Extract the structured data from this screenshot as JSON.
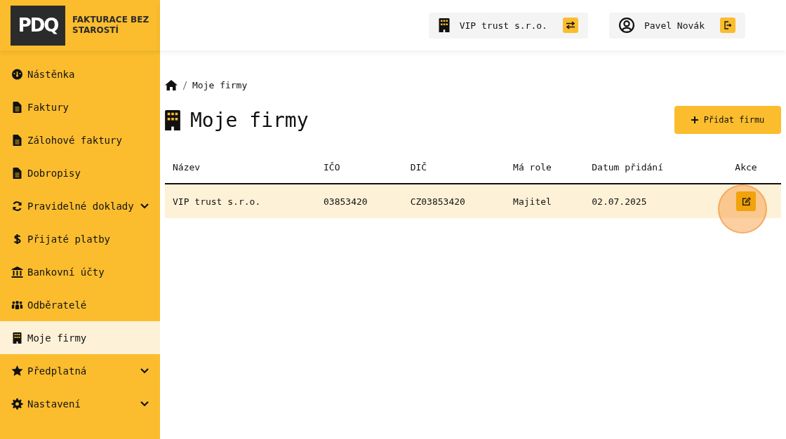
{
  "logo": {
    "mark": "PDQ",
    "tagline": "FAKTURACE BEZ STAROSTÍ"
  },
  "sidebar": {
    "items": [
      {
        "label": "Nástěnka",
        "kind": "gauge",
        "selected": false,
        "expandable": false
      },
      {
        "label": "Faktury",
        "kind": "file",
        "selected": false,
        "expandable": false
      },
      {
        "label": "Zálohové faktury",
        "kind": "file",
        "selected": false,
        "expandable": false
      },
      {
        "label": "Dobropisy",
        "kind": "file",
        "selected": false,
        "expandable": false
      },
      {
        "label": "Pravidelné doklady",
        "kind": "sync",
        "selected": false,
        "expandable": true
      },
      {
        "label": "Přijaté platby",
        "kind": "dollar",
        "selected": false,
        "expandable": false
      },
      {
        "label": "Bankovní účty",
        "kind": "bank",
        "selected": false,
        "expandable": false
      },
      {
        "label": "Odběratelé",
        "kind": "people",
        "selected": false,
        "expandable": false
      },
      {
        "label": "Moje firmy",
        "kind": "building",
        "selected": true,
        "expandable": false
      },
      {
        "label": "Předplatná",
        "kind": "star",
        "selected": false,
        "expandable": true
      },
      {
        "label": "Nastavení",
        "kind": "gear",
        "selected": false,
        "expandable": true
      }
    ]
  },
  "header": {
    "company": "VIP trust s.r.o.",
    "user": "Pavel Novák"
  },
  "breadcrumb": [
    "Moje firmy"
  ],
  "page": {
    "title": "Moje firmy",
    "add_button": "Přidat firmu"
  },
  "table": {
    "columns": [
      "Název",
      "IČO",
      "DIČ",
      "Má role",
      "Datum přidání",
      "Akce"
    ],
    "rows": [
      {
        "cells": [
          "VIP trust s.r.o.",
          "03853420",
          "CZ03853420",
          "Majitel",
          "02.07.2025"
        ],
        "selected": true
      }
    ]
  }
}
